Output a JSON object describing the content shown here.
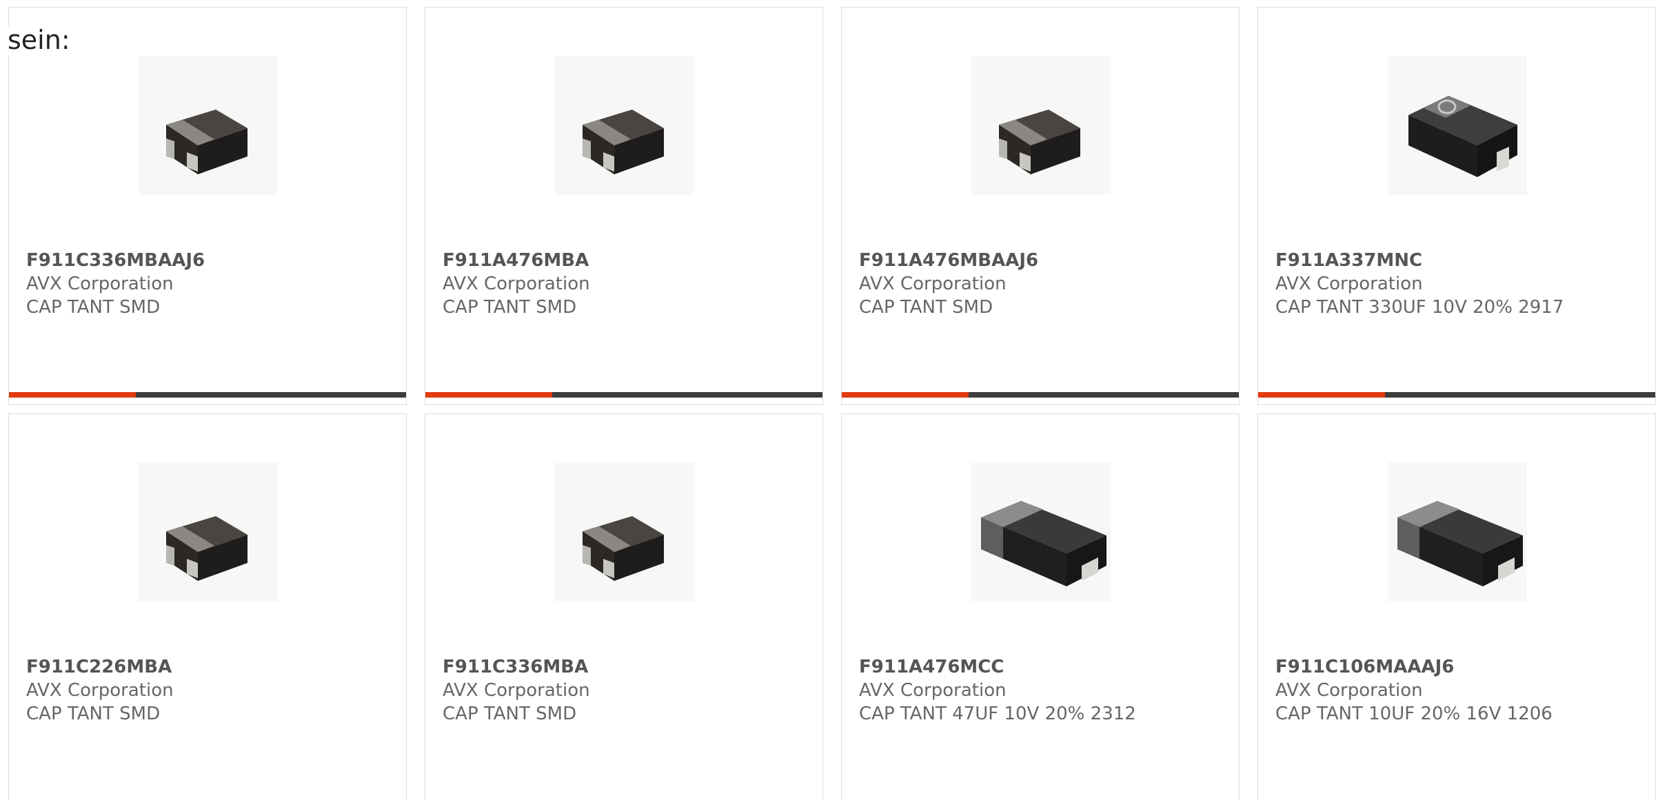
{
  "caption": "sein:",
  "accent_color": "#e03c10",
  "bar_color": "#3d3d3d",
  "products": [
    {
      "part_number": "F911C336MBAAJ6",
      "manufacturer": "AVX Corporation",
      "description": "CAP TANT SMD",
      "image": "tantalum-capacitor-small-icon",
      "progress": 0.32
    },
    {
      "part_number": "F911A476MBA",
      "manufacturer": "AVX Corporation",
      "description": "CAP TANT SMD",
      "image": "tantalum-capacitor-small-icon",
      "progress": 0.32
    },
    {
      "part_number": "F911A476MBAAJ6",
      "manufacturer": "AVX Corporation",
      "description": "CAP TANT SMD",
      "image": "tantalum-capacitor-small-icon",
      "progress": 0.32
    },
    {
      "part_number": "F911A337MNC",
      "manufacturer": "AVX Corporation",
      "description": "CAP TANT 330UF 10V 20% 2917",
      "image": "tantalum-capacitor-large-icon",
      "progress": 0.32
    },
    {
      "part_number": "F911C226MBA",
      "manufacturer": "AVX Corporation",
      "description": "CAP TANT SMD",
      "image": "tantalum-capacitor-small-icon"
    },
    {
      "part_number": "F911C336MBA",
      "manufacturer": "AVX Corporation",
      "description": "CAP TANT SMD",
      "image": "tantalum-capacitor-small-icon"
    },
    {
      "part_number": "F911A476MCC",
      "manufacturer": "AVX Corporation",
      "description": "CAP TANT 47UF 10V 20% 2312",
      "image": "tantalum-capacitor-rect-icon"
    },
    {
      "part_number": "F911C106MAAAJ6",
      "manufacturer": "AVX Corporation",
      "description": "CAP TANT 10UF 20% 16V 1206",
      "image": "tantalum-capacitor-rect-icon"
    }
  ]
}
